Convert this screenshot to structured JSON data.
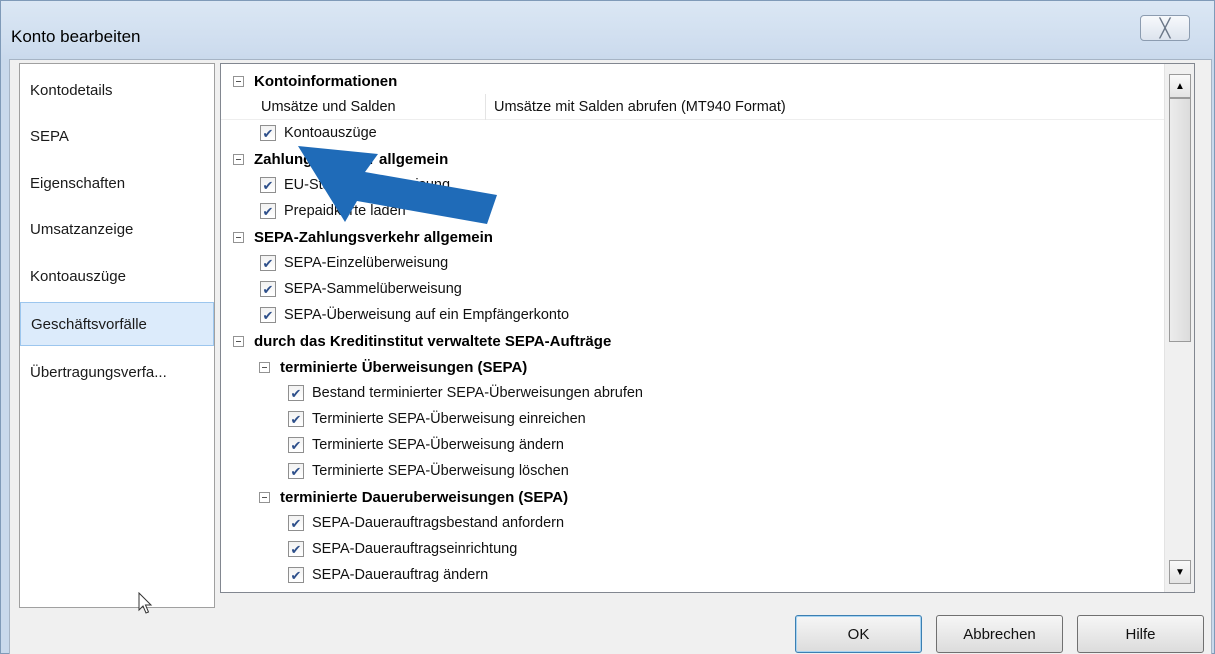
{
  "window": {
    "title": "Konto bearbeiten",
    "close_glyph": "╳"
  },
  "sidebar": {
    "items": [
      {
        "label": "Kontodetails",
        "selected": false
      },
      {
        "label": "SEPA",
        "selected": false
      },
      {
        "label": "Eigenschaften",
        "selected": false
      },
      {
        "label": "Umsatzanzeige",
        "selected": false
      },
      {
        "label": "Kontoauszüge",
        "selected": false
      },
      {
        "label": "Geschäftsvorfälle",
        "selected": true
      },
      {
        "label": "Übertragungsverfa...",
        "selected": false
      }
    ]
  },
  "tree": {
    "groups": [
      {
        "label": "Kontoinformationen"
      },
      {
        "label": "Zahlungsverkehr allgemein"
      },
      {
        "label": "SEPA-Zahlungsverkehr allgemein"
      },
      {
        "label": "durch das Kreditinstitut verwaltete SEPA-Aufträge"
      },
      {
        "label": "terminierte Überweisungen (SEPA)"
      },
      {
        "label": "terminierte Daueruberweisungen (SEPA)"
      }
    ],
    "property": {
      "name": "Umsätze und Salden",
      "value": "Umsätze mit Salden abrufen (MT940 Format)"
    },
    "items": [
      {
        "label": "Kontoauszüge",
        "checked": true
      },
      {
        "label": "EU-Standardüberweisung",
        "checked": true
      },
      {
        "label": "Prepaidkarte laden",
        "checked": true
      },
      {
        "label": "SEPA-Einzelüberweisung",
        "checked": true
      },
      {
        "label": "SEPA-Sammelüberweisung",
        "checked": true
      },
      {
        "label": "SEPA-Überweisung auf ein Empfängerkonto",
        "checked": true
      },
      {
        "label": "Bestand terminierter SEPA-Überweisungen abrufen",
        "checked": true
      },
      {
        "label": "Terminierte SEPA-Überweisung einreichen",
        "checked": true
      },
      {
        "label": "Terminierte SEPA-Überweisung ändern",
        "checked": true
      },
      {
        "label": "Terminierte SEPA-Überweisung löschen",
        "checked": true
      },
      {
        "label": "SEPA-Dauerauftragsbestand anfordern",
        "checked": true
      },
      {
        "label": "SEPA-Dauerauftragseinrichtung",
        "checked": true
      },
      {
        "label": "SEPA-Dauerauftrag ändern",
        "checked": true
      }
    ],
    "check_glyph": "✔"
  },
  "scrollbar": {
    "up_glyph": "▲",
    "down_glyph": "▼"
  },
  "buttons": {
    "ok": "OK",
    "cancel": "Abbrechen",
    "help": "Hilfe"
  },
  "colors": {
    "annotation_arrow": "#1f6bb8",
    "selection": "#dcebfb"
  },
  "icons": {
    "close": "close-icon",
    "expander": "collapse-icon",
    "checkbox": "checkmark-icon",
    "cursor": "mouse-pointer-icon",
    "annotation": "arrow-annotation-icon"
  }
}
